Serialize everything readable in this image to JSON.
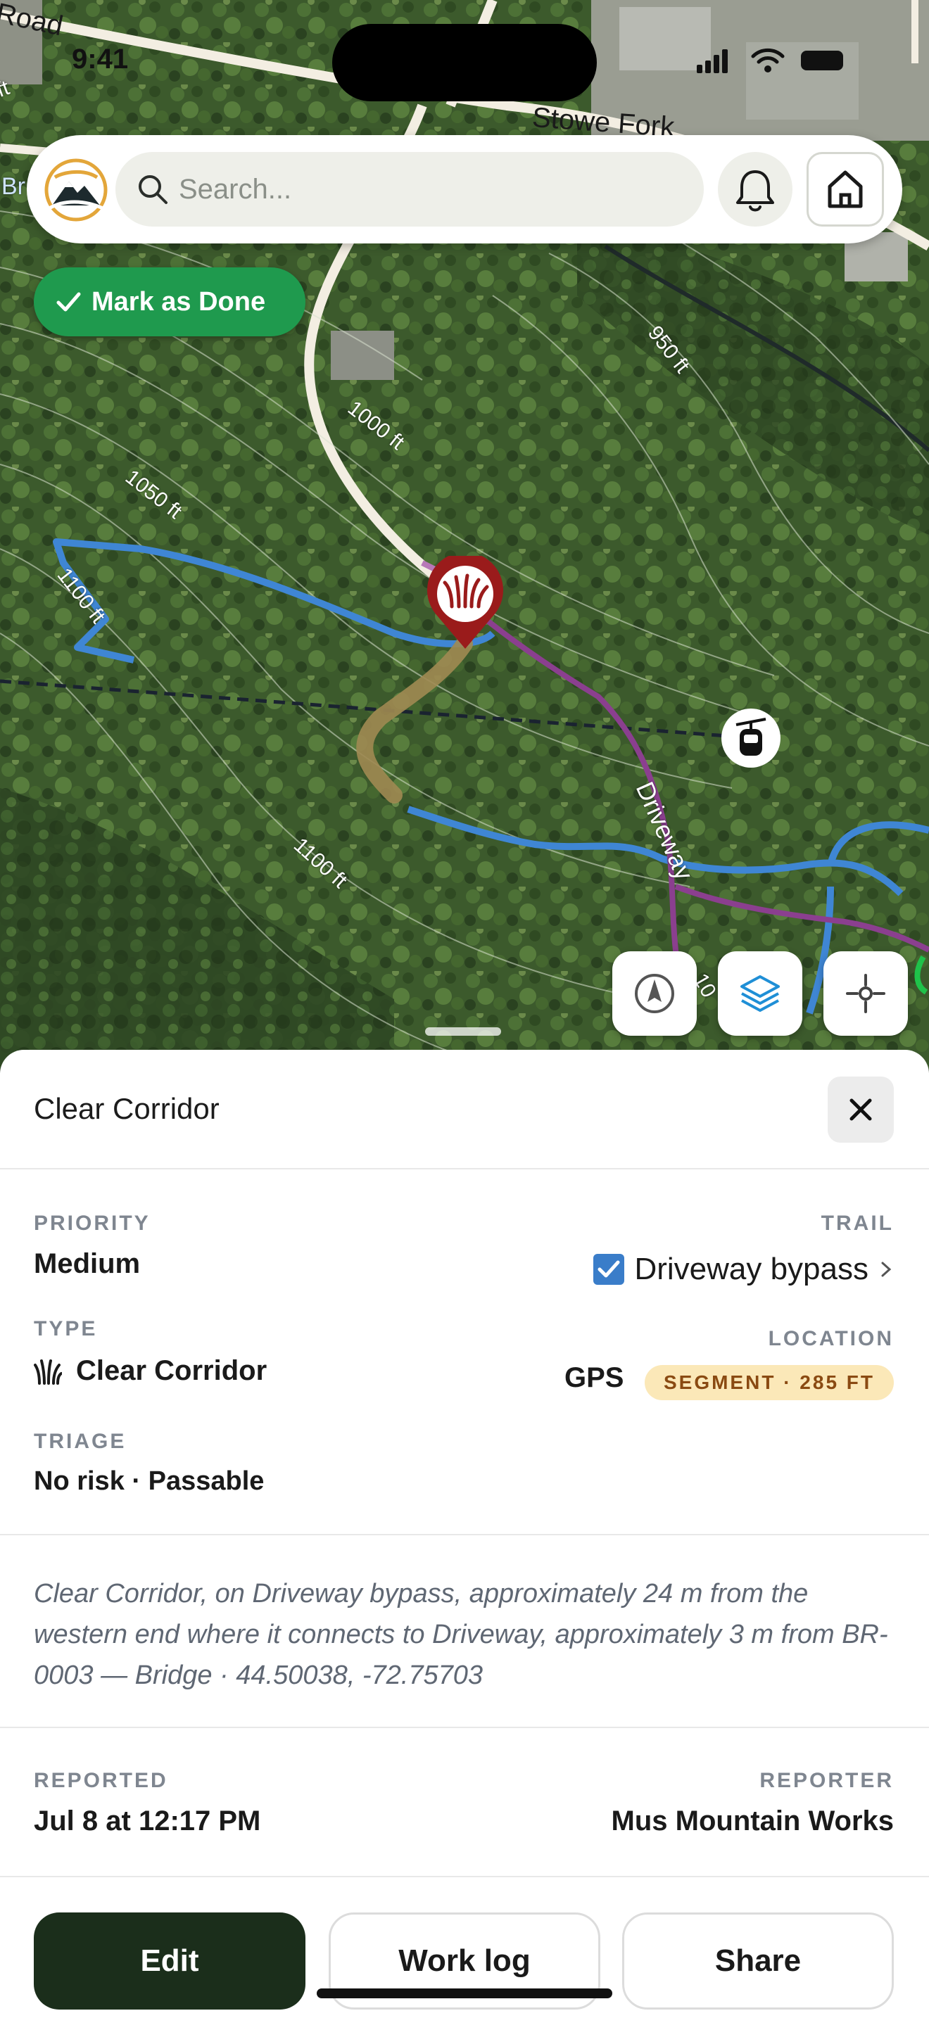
{
  "status_bar": {
    "time": "9:41"
  },
  "map": {
    "road_labels": [
      "Road",
      "Stowe Fork",
      "Br"
    ],
    "contour_labels": [
      "950 ft",
      "1000 ft",
      "1050 ft",
      "1100 ft",
      "1100 ft",
      "10"
    ],
    "elevation_edge": "ft",
    "trail_label": "Driveway",
    "colors": {
      "trail_blue": "#3f86d4",
      "trail_purple": "#8b3f8f",
      "segment_highlight": "#a08a52",
      "marker_red": "#9a1b1b"
    },
    "controls": [
      {
        "name": "compass",
        "icon": "compass-icon"
      },
      {
        "name": "layers",
        "icon": "layers-icon"
      },
      {
        "name": "locate",
        "icon": "crosshair-icon"
      }
    ]
  },
  "search": {
    "placeholder": "Search..."
  },
  "mark_done": {
    "label": "Mark as Done",
    "color": "#1f9a4e"
  },
  "sheet": {
    "title": "Clear Corridor",
    "priority": {
      "label": "PRIORITY",
      "value": "Medium"
    },
    "trail": {
      "label": "TRAIL",
      "value": "Driveway bypass"
    },
    "type": {
      "label": "TYPE",
      "value": "Clear Corridor",
      "icon": "grass-icon"
    },
    "location": {
      "label": "LOCATION",
      "value": "GPS",
      "badge": "SEGMENT · 285 FT"
    },
    "triage": {
      "label": "TRIAGE",
      "value": "No risk · Passable"
    },
    "description": "Clear Corridor, on Driveway bypass, approximately 24 m from the western end where it connects to Driveway, approximately 3 m from BR-0003 — Bridge · 44.50038, -72.75703",
    "reported": {
      "label": "REPORTED",
      "value": "Jul 8 at 12:17 PM"
    },
    "reporter": {
      "label": "REPORTER",
      "value": "Mus Mountain Works"
    }
  },
  "actions": {
    "edit": "Edit",
    "work_log": "Work log",
    "share": "Share"
  }
}
